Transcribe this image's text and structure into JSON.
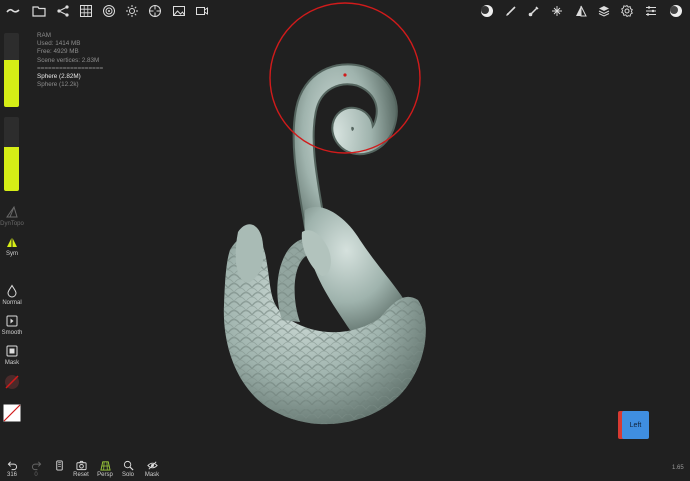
{
  "stats": {
    "ram_label": "RAM",
    "used": "Used: 1414 MB",
    "free": "Free: 4929 MB",
    "scene_vertices": "Scene vertices: 2.83M",
    "separator": "==================",
    "objects": [
      "Sphere (2.82M)",
      "Sphere (12.2k)"
    ]
  },
  "sliders": {
    "radius_fill": 0.63,
    "intensity_fill": 0.6,
    "accent_color": "#d6ee16"
  },
  "tools": {
    "dyntopo": "DynTopo",
    "sym": "Sym",
    "normal": "Normal",
    "smooth": "Smooth",
    "mask": "Mask"
  },
  "bottom": {
    "undo_count": "316",
    "redo_count": "0",
    "reset": "Reset",
    "persp": "Persp",
    "solo": "Solo",
    "mask": "Mask"
  },
  "viewcube": {
    "label": "Left"
  },
  "fps": "1.65",
  "colors": {
    "background": "#202020",
    "brush_ring": "#d11b1b",
    "model": "#9fb3ad"
  }
}
